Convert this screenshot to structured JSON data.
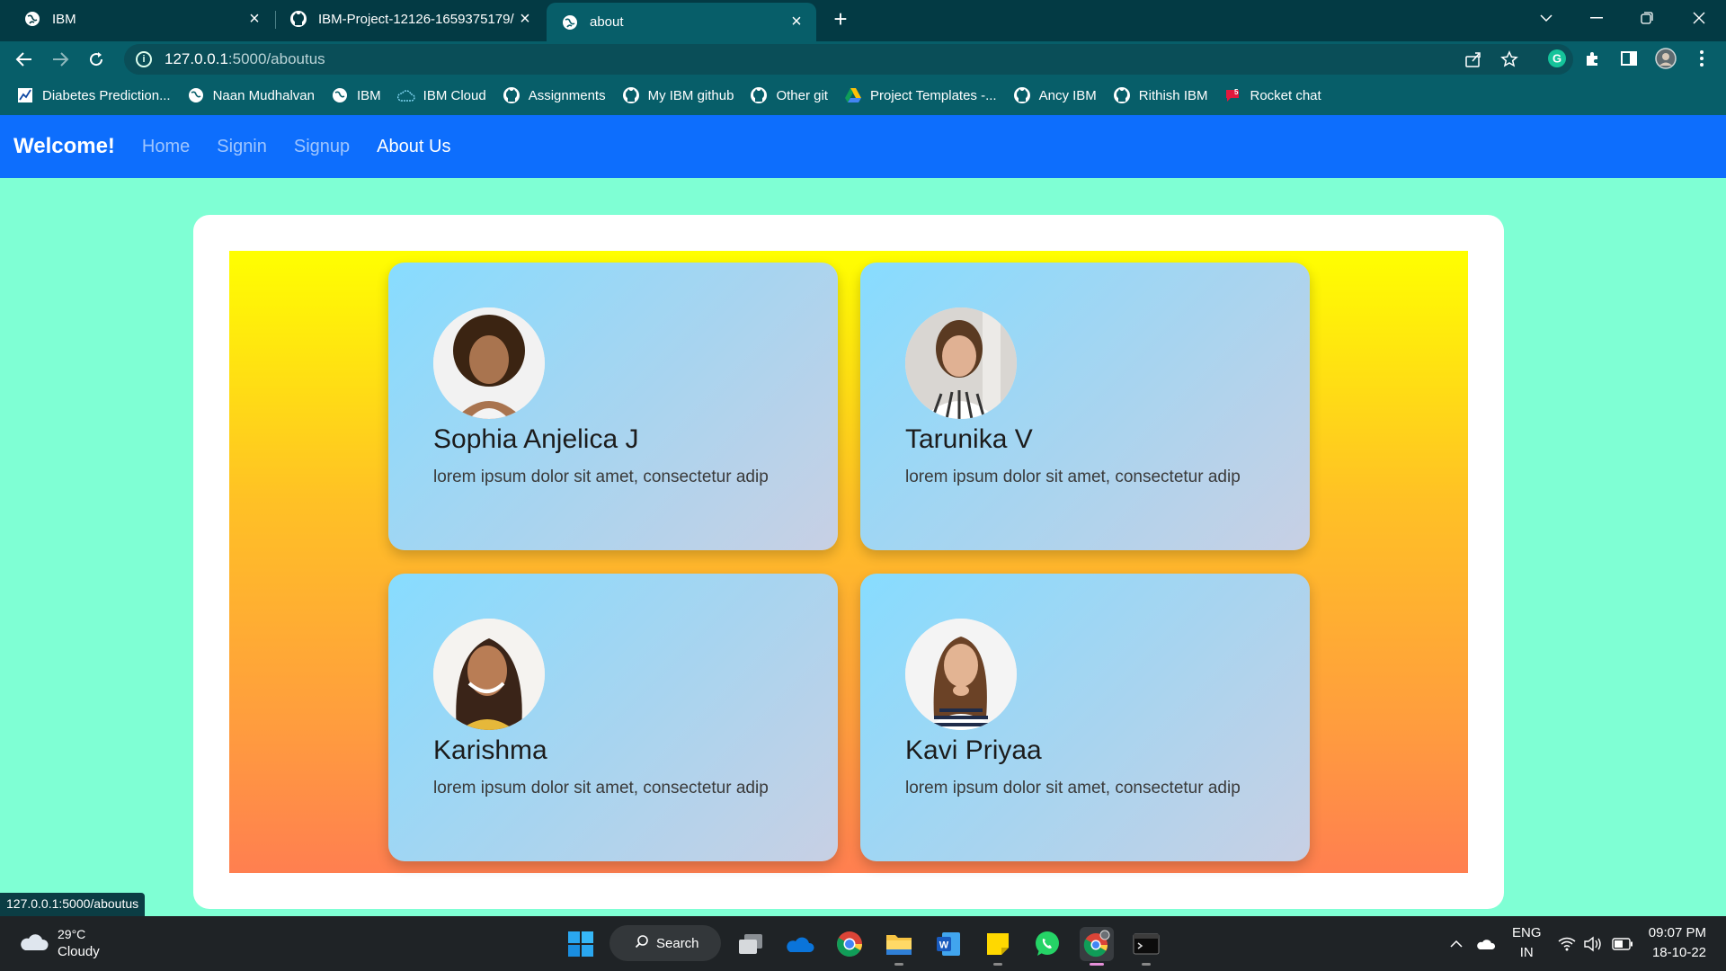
{
  "browser": {
    "tabs": [
      {
        "title": "IBM",
        "icon": "globe-icon",
        "active": false
      },
      {
        "title": "IBM-Project-12126-1659375179/",
        "icon": "github-icon",
        "active": false
      },
      {
        "title": "about",
        "icon": "globe-icon",
        "active": true
      }
    ],
    "url": {
      "host": "127.0.0.1",
      "rest": ":5000/aboutus"
    },
    "bookmarks": [
      {
        "label": "Diabetes Prediction...",
        "icon": "chart-icon"
      },
      {
        "label": "Naan Mudhalvan",
        "icon": "globe-icon"
      },
      {
        "label": "IBM",
        "icon": "globe-icon"
      },
      {
        "label": "IBM Cloud",
        "icon": "cloud-icon"
      },
      {
        "label": "Assignments",
        "icon": "github-icon"
      },
      {
        "label": "My IBM github",
        "icon": "github-icon"
      },
      {
        "label": "Other git",
        "icon": "github-icon"
      },
      {
        "label": "Project Templates -...",
        "icon": "drive-icon"
      },
      {
        "label": "Ancy IBM",
        "icon": "github-icon"
      },
      {
        "label": "Rithish IBM",
        "icon": "github-icon"
      },
      {
        "label": "Rocket chat",
        "icon": "rocket-chat-icon"
      }
    ],
    "status_url": "127.0.0.1:5000/aboutus"
  },
  "navbar": {
    "brand": "Welcome!",
    "links": [
      {
        "label": "Home",
        "active": false
      },
      {
        "label": "Signin",
        "active": false
      },
      {
        "label": "Signup",
        "active": false
      },
      {
        "label": "About Us",
        "active": true
      }
    ]
  },
  "team": [
    {
      "name": "Sophia Anjelica J",
      "desc": "lorem ipsum dolor sit amet, consectetur adip"
    },
    {
      "name": "Tarunika V",
      "desc": "lorem ipsum dolor sit amet, consectetur adip"
    },
    {
      "name": "Karishma",
      "desc": "lorem ipsum dolor sit amet, consectetur adip"
    },
    {
      "name": "Kavi Priyaa",
      "desc": "lorem ipsum dolor sit amet, consectetur adip"
    }
  ],
  "taskbar": {
    "weather": {
      "temp": "29°C",
      "condition": "Cloudy"
    },
    "search_label": "Search",
    "lang": {
      "line1": "ENG",
      "line2": "IN"
    },
    "clock": {
      "time": "09:07 PM",
      "date": "18-10-22"
    }
  }
}
